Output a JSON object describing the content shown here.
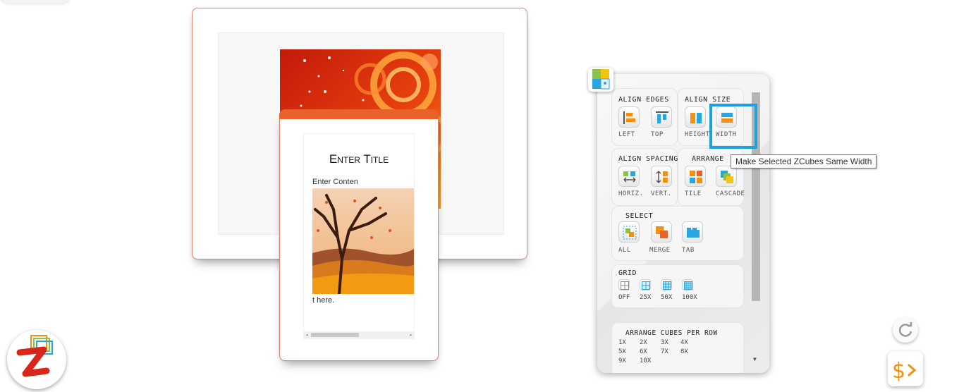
{
  "cards": {
    "front": {
      "title": "Enter Title",
      "content_start": "Enter Conten",
      "content_end": "t here."
    }
  },
  "panel": {
    "align_edges": {
      "label": "ALIGN EDGES",
      "left": "LEFT",
      "top": "TOP"
    },
    "align_size": {
      "label": "ALIGN SIZE",
      "height": "HEIGHT",
      "width": "WIDTH"
    },
    "align_spacing": {
      "label": "ALIGN SPACING",
      "horiz": "HORIZ.",
      "vert": "VERT."
    },
    "arrange": {
      "label": "ARRANGE",
      "tile": "TILE",
      "cascade": "CASCADE"
    },
    "select": {
      "label": "SELECT",
      "all": "ALL",
      "merge": "MERGE",
      "tab": "TAB"
    },
    "grid": {
      "label": "GRID",
      "off": "OFF",
      "g25": "25X",
      "g50": "50X",
      "g100": "100X"
    },
    "per_row": {
      "label": "ARRANGE CUBES PER ROW",
      "options": [
        "1X",
        "2X",
        "3X",
        "4X",
        "5X",
        "6X",
        "7X",
        "8X",
        "9X",
        "10X"
      ]
    }
  },
  "tooltip": "Make Selected ZCubes Same Width",
  "icons": [
    "panel-images-icon",
    "zcubes-logo-icon",
    "refresh-icon",
    "dollar-prompt-icon"
  ],
  "colors": {
    "accent_highlight": "#1ba1e2",
    "card_border": "#e8826a",
    "orange": "#f29111"
  }
}
